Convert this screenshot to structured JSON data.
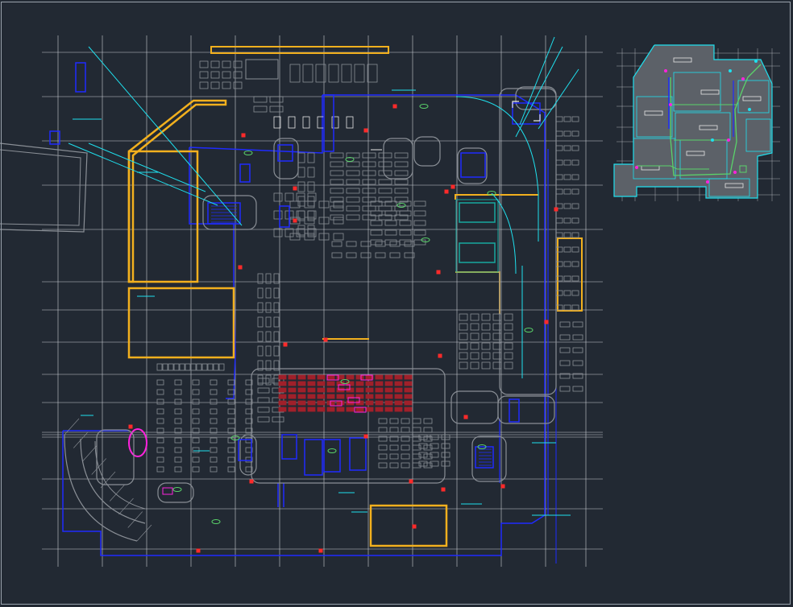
{
  "app": {
    "view": "cad-model-space"
  },
  "colors": {
    "background": "#222933",
    "frame": "#9aa3ad",
    "grid": "#c9cdd3",
    "blue": "#1f2bff",
    "yellow": "#f2b01e",
    "cyan": "#1fe0ee",
    "gray": "#8a8f96",
    "white": "#e6e6e6",
    "red": "#ff2a2a",
    "magenta": "#ff22dd",
    "green": "#5ad36a",
    "darkred": "#a0202a",
    "teal": "#17a99f",
    "keyplan_hatch": "#5c6168"
  },
  "drawing": {
    "main_plan": {
      "name": "floor-plan"
    },
    "key_plan": {
      "name": "key-plan"
    }
  }
}
